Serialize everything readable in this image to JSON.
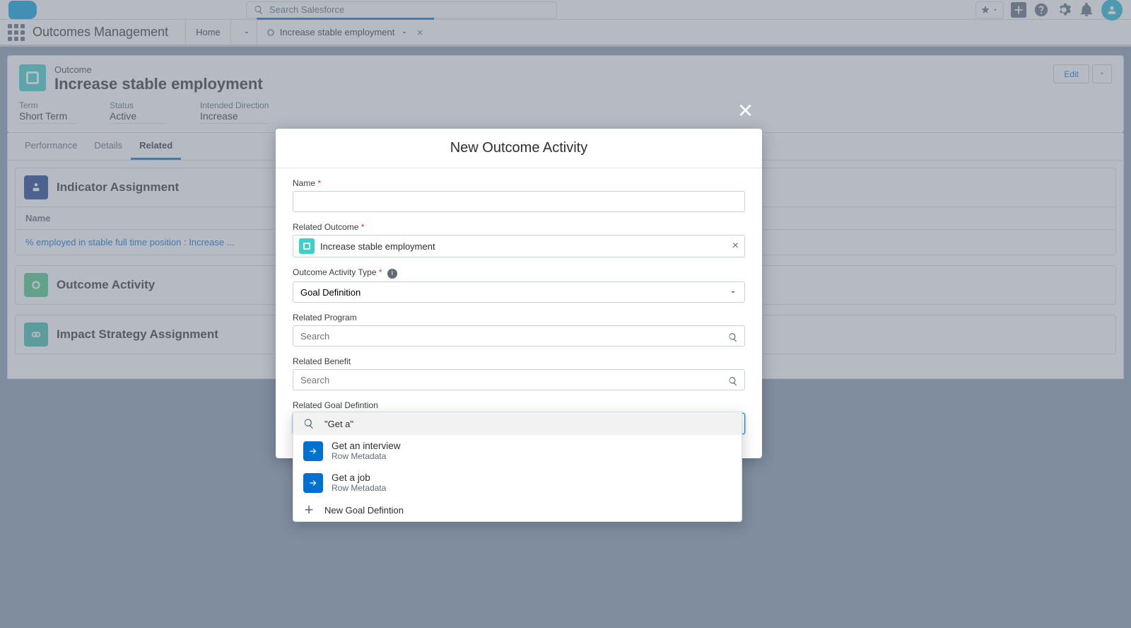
{
  "global_search_placeholder": "Search Salesforce",
  "app_name": "Outcomes Management",
  "nav": {
    "home": "Home",
    "record_tab": "Increase stable employment"
  },
  "record": {
    "type_label": "Outcome",
    "title": "Increase stable employment",
    "edit_button": "Edit",
    "fields": {
      "term": {
        "label": "Term",
        "value": "Short Term"
      },
      "status": {
        "label": "Status",
        "value": "Active"
      },
      "direction": {
        "label": "Intended Direction",
        "value": "Increase"
      }
    }
  },
  "tabs": {
    "performance": "Performance",
    "details": "Details",
    "related": "Related"
  },
  "related": {
    "indicator": {
      "title": "Indicator Assignment",
      "col_name": "Name",
      "row1": "% employed in stable full time position : Increase ..."
    },
    "outcome_activity": {
      "title": "Outcome Activity"
    },
    "impact_strategy": {
      "title": "Impact Strategy Assignment"
    }
  },
  "modal": {
    "title": "New Outcome Activity",
    "name_label": "Name",
    "related_outcome_label": "Related Outcome",
    "related_outcome_value": "Increase stable employment",
    "activity_type_label": "Outcome Activity Type",
    "activity_type_value": "Goal Definition",
    "related_program_label": "Related Program",
    "related_benefit_label": "Related Benefit",
    "related_goal_label": "Related Goal Defintion",
    "search_placeholder": "Search",
    "goal_input_value": "Get a",
    "listbox": {
      "query_item": "\"Get a\"",
      "option1": {
        "name": "Get an interview",
        "sub": "Row Metadata"
      },
      "option2": {
        "name": "Get a job",
        "sub": "Row Metadata"
      },
      "new_action": "New Goal Defintion"
    }
  }
}
